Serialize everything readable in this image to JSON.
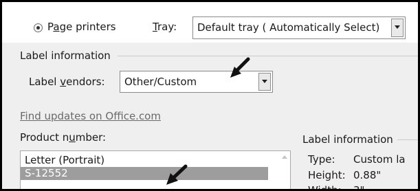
{
  "printer": {
    "page_printers_label": "Page printers",
    "tray_label": "Tray:",
    "tray_value": "Default tray ( Automatically Select)"
  },
  "label_information": {
    "group_title": "Label information",
    "vendors_label": "Label vendors:",
    "vendors_value": "Other/Custom"
  },
  "find_updates_link": "Find updates on Office.com",
  "product_number": {
    "label": "Product number:",
    "items": [
      "Letter (Portrait)",
      "S-12552"
    ],
    "selected_index": 1
  },
  "label_info_panel": {
    "title": "Label information",
    "rows": [
      {
        "key": "Type:",
        "value": "Custom la"
      },
      {
        "key": "Height:",
        "value": "0.88\""
      },
      {
        "key": "Width:",
        "value": "3\""
      }
    ]
  },
  "annotations": [
    {
      "icon": "arrow-pointer-icon",
      "target": "label-vendors-select"
    },
    {
      "icon": "arrow-pointer-icon",
      "target": "product-list-item"
    }
  ]
}
